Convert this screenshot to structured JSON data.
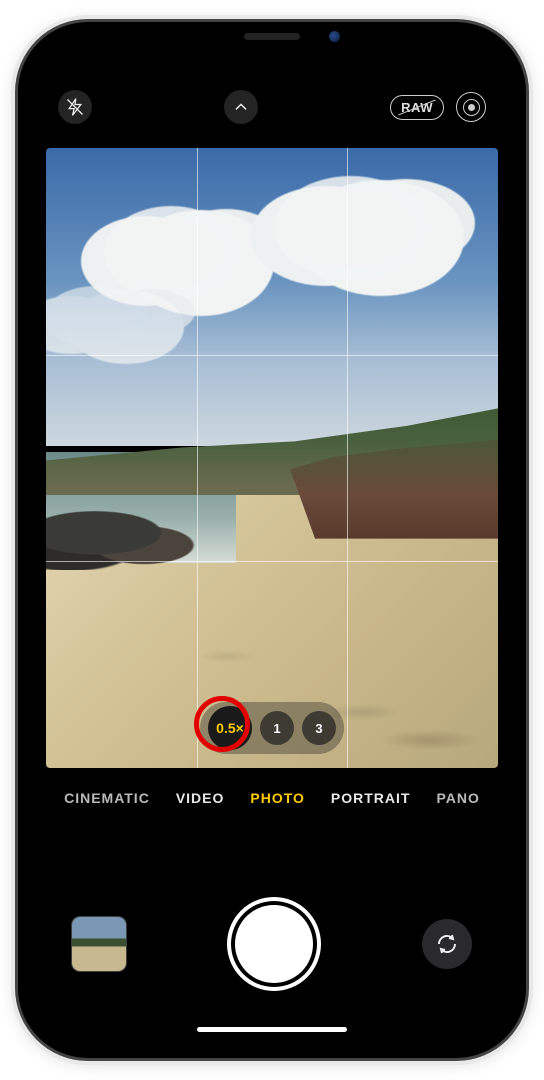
{
  "top_controls": {
    "flash_state": "off",
    "raw_label": "RAW",
    "raw_enabled": false,
    "live_photo_enabled": true
  },
  "zoom": {
    "options": [
      {
        "label": "0.5×",
        "active": true
      },
      {
        "label": "1",
        "active": false
      },
      {
        "label": "3",
        "active": false
      }
    ],
    "highlighted_index": 0
  },
  "modes": {
    "items": [
      "CINEMATIC",
      "VIDEO",
      "PHOTO",
      "PORTRAIT",
      "PANO"
    ],
    "active_index": 2
  },
  "annotation": {
    "ring_color": "#e20000"
  }
}
